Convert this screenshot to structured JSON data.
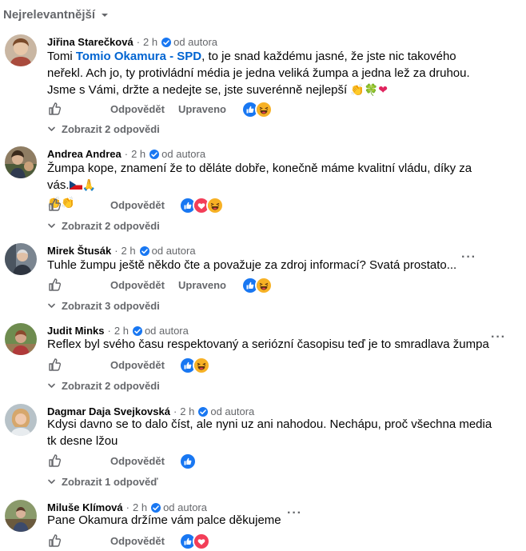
{
  "sort_label": "Nejrelevantnější",
  "fan_label": "od autora",
  "reply_label": "Odpovědět",
  "edited_label": "Upraveno",
  "comments": [
    {
      "author": "Jiřina Starečková",
      "time": "2 h",
      "text_parts": [
        "Tomi ",
        "Tomio Okamura - SPD",
        ", to je snad každému jasné, že jste nic takového neřekl. Ach jo, ty protivládní média je jedna veliká žumpa a jedna lež za druhou."
      ],
      "text_line2": "Jsme s Vámi, držte a nedejte se, jste suverénně nejlepší",
      "emoji": [
        "clapping-hands",
        "four-leaf-clover",
        "red-heart"
      ],
      "reactions": [
        "like",
        "haha"
      ],
      "replies": "Zobrazit 2 odpovědi"
    },
    {
      "author": "Andrea Andrea",
      "time": "2 h",
      "text": "Žumpa kope, znamení že to děláte dobře, konečně máme kvalitní vládu, díky za vás.",
      "emoji": [
        "czech-flag",
        "folded-hands",
        "clapping-hands",
        "clapping-hands"
      ],
      "reactions": [
        "like",
        "love",
        "haha"
      ],
      "replies": "Zobrazit 2 odpovědi"
    },
    {
      "author": "Mirek Štusák",
      "time": "2 h",
      "text": "Tuhle žumpu ještě někdo čte a považuje za zdroj informací? Svatá prostato...",
      "reactions": [
        "like",
        "haha"
      ],
      "replies": "Zobrazit 3 odpovědi"
    },
    {
      "author": "Judit Minks",
      "time": "2 h",
      "text": "Reflex byl svého času respektovaný a seriózní časopisu teď je to smradlava žumpa",
      "reactions": [
        "like",
        "haha"
      ],
      "replies": "Zobrazit 2 odpovědi"
    },
    {
      "author": "Dagmar Daja Svejkovská",
      "time": "2 h",
      "text": "Kdysi davno se to dalo číst, ale nyni uz ani nahodou. Nechápu, proč všechna media tk desne lžou",
      "reactions": [
        "like"
      ],
      "replies": "Zobrazit 1 odpověď"
    },
    {
      "author": "Miluše Klímová",
      "time": "2 h",
      "text": "Pane Okamura držíme vám palce děkujeme",
      "reactions": [
        "like",
        "love"
      ]
    }
  ],
  "colors": {
    "link": "#0064d1",
    "secondary": "#65676b",
    "like": "#1877f2",
    "love": "#f33e58",
    "haha": "#f7b125"
  }
}
